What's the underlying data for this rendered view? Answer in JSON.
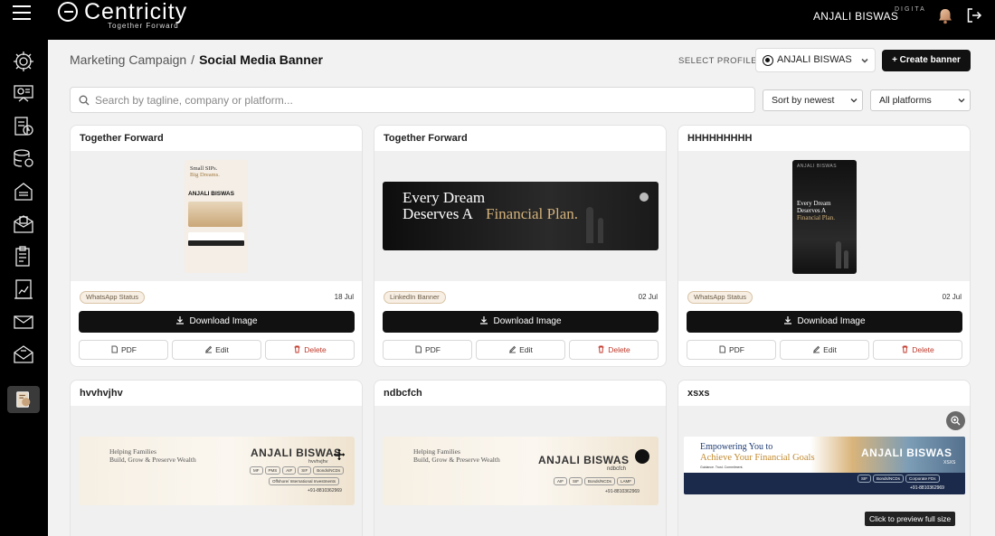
{
  "topbar": {
    "brand_name": "Centricity",
    "brand_tagline": "Together Forward",
    "user_name": "ANJALI BISWAS",
    "user_subtext": "DIGITA"
  },
  "breadcrumb": {
    "parent": "Marketing Campaign",
    "separator": "/",
    "current": "Social Media Banner"
  },
  "profile": {
    "label": "SELECT PROFILE",
    "selected": "ANJALI BISWAS"
  },
  "create_button": "+ Create banner",
  "search": {
    "placeholder": "Search by tagline, company or platform...",
    "value": ""
  },
  "filters": {
    "sort": "Sort by newest",
    "platform": "All platforms"
  },
  "sidebar": {
    "items": [
      "settings-icon",
      "presentation-icon",
      "report-icon",
      "database-icon",
      "document-icon",
      "mailbox-icon",
      "clipboard-icon",
      "analytics-icon",
      "mail-icon",
      "envelope-icon",
      "banner-icon"
    ]
  },
  "actions": {
    "download": "Download Image",
    "pdf": "PDF",
    "edit": "Edit",
    "delete": "Delete"
  },
  "cards": [
    {
      "title": "Together Forward",
      "platform": "WhatsApp Status",
      "date": "18 Jul",
      "preview": {
        "line1": "Small SIPs.",
        "line2": "Big Dreams.",
        "name": "ANJALI BISWAS"
      }
    },
    {
      "title": "Together Forward",
      "platform": "LinkedIn Banner",
      "date": "02 Jul",
      "preview": {
        "line1": "Every Dream",
        "line2": "Deserves A",
        "line3": "Financial Plan."
      }
    },
    {
      "title": "HHHHHHHHH",
      "platform": "WhatsApp Status",
      "date": "02 Jul",
      "preview": {
        "name": "ANJALI BISWAS",
        "line1": "Every Dream",
        "line2": "Deserves A",
        "line3": "Financial Plan."
      }
    },
    {
      "title": "hvvhvjhv",
      "preview": {
        "line1": "Helping Families",
        "line2": "Build, Grow & Preserve Wealth",
        "name": "ANJALI BISWAS",
        "sub": "hvvhvjhv",
        "tags": [
          "MF",
          "PMS",
          "AIF",
          "SIF",
          "Bonds/NCDs"
        ],
        "extra": "Offshore/ International Investments",
        "phone": "+91-8810362969"
      }
    },
    {
      "title": "ndbcfch",
      "preview": {
        "line1": "Helping Families",
        "line2": "Build, Grow & Preserve Wealth",
        "name": "ANJALI BISWAS",
        "sub": "ndbcfch",
        "tags": [
          "AIF",
          "SIF",
          "Bonds/NCDs",
          "LAMF"
        ],
        "phone": "+91-8810362969"
      }
    },
    {
      "title": "xsxs",
      "preview": {
        "line1": "Empowering You to",
        "line2": "Achieve Your Financial Goals",
        "line3": "Guidance. Trust. Commitment.",
        "name": "ANJALI BISWAS",
        "sub": "XSXS",
        "tags": [
          "SIF",
          "Bonds/NCDs",
          "Corporate FDs"
        ],
        "phone": "+91-8810362969"
      }
    }
  ],
  "tooltip": "Click to preview full size"
}
